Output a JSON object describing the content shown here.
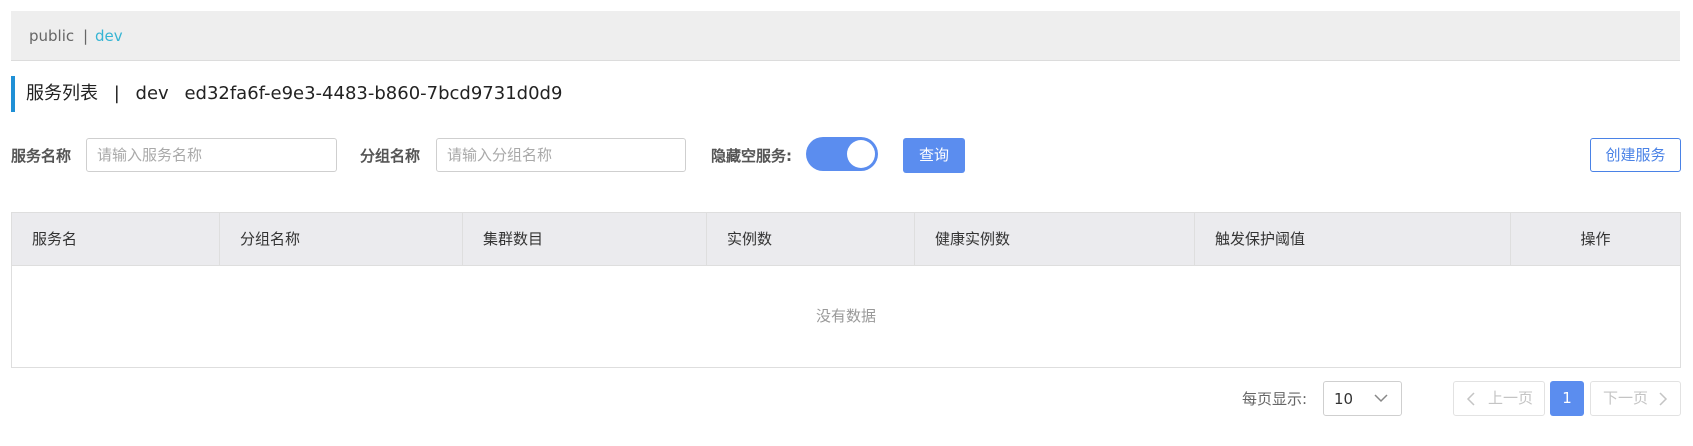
{
  "namespace_bar": {
    "items": [
      {
        "label": "public"
      },
      {
        "label": "dev"
      }
    ],
    "separator": "|",
    "active": "dev"
  },
  "title": {
    "prefix": "服务列表",
    "separator": "|",
    "namespace": "dev",
    "namespace_id": "ed32fa6f-e9e3-4483-b860-7bcd9731d0d9"
  },
  "filters": {
    "service_name_label": "服务名称",
    "service_name_placeholder": "请输入服务名称",
    "service_name_value": "",
    "group_name_label": "分组名称",
    "group_name_placeholder": "请输入分组名称",
    "group_name_value": "",
    "hide_empty_label": "隐藏空服务:",
    "hide_empty_on": true,
    "query_button": "查询",
    "create_button": "创建服务"
  },
  "table": {
    "columns": [
      "服务名",
      "分组名称",
      "集群数目",
      "实例数",
      "健康实例数",
      "触发保护阈值",
      "操作"
    ],
    "rows": [],
    "empty_text": "没有数据"
  },
  "pagination": {
    "page_size_label": "每页显示:",
    "page_size": "10",
    "prev_label": "上一页",
    "next_label": "下一页",
    "current_page": "1"
  },
  "colors": {
    "accent": "#5b8def",
    "namespace_active": "#37b5d4",
    "title_bar": "#1f90d6"
  }
}
